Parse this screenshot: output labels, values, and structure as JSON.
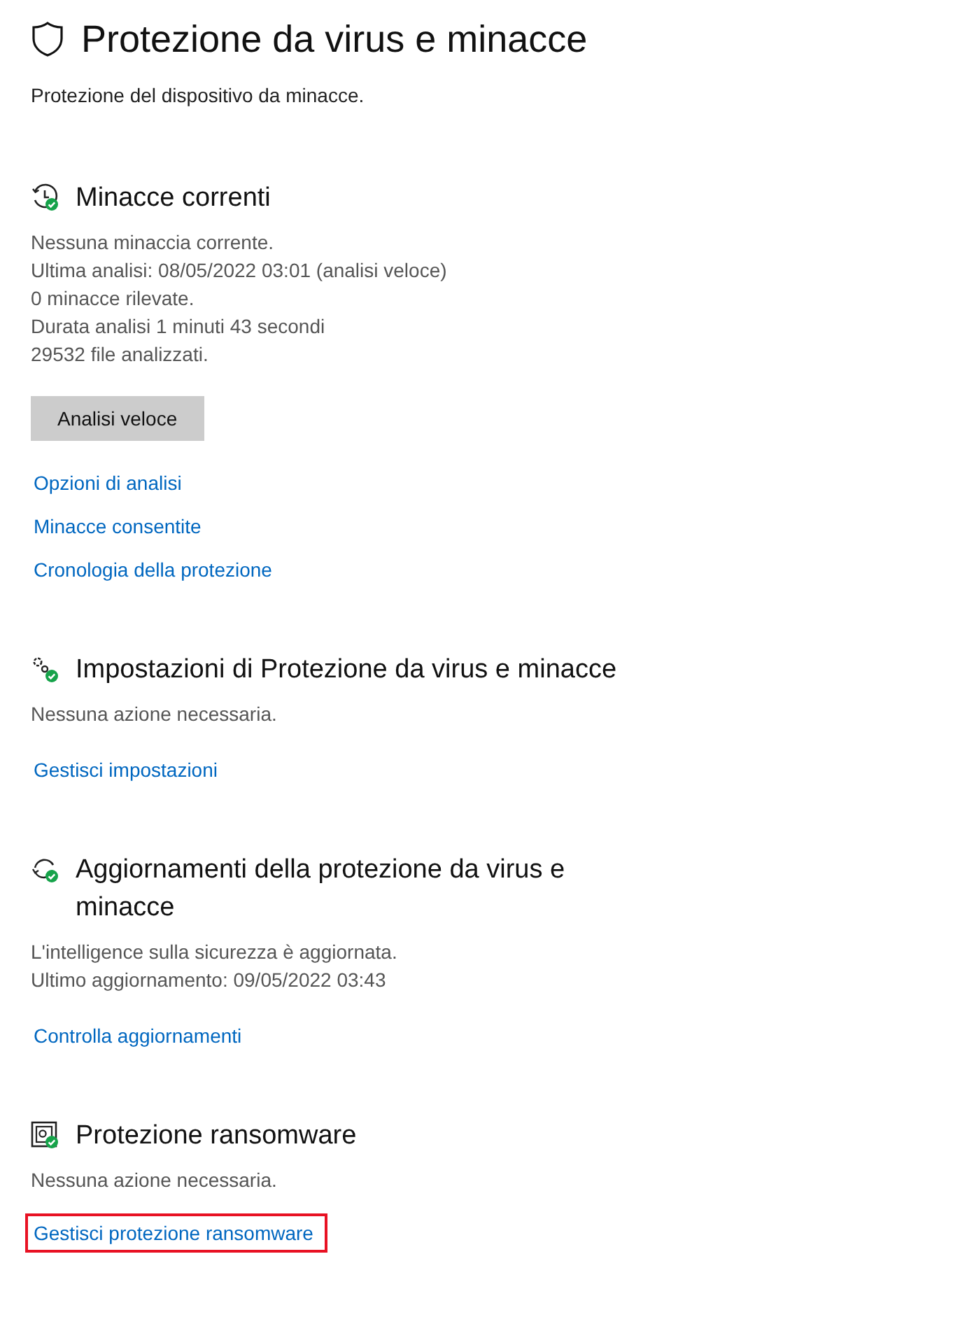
{
  "page": {
    "title": "Protezione da virus e minacce",
    "subtitle": "Protezione del dispositivo da minacce."
  },
  "sections": [
    {
      "kind": "clock",
      "title": "Minacce correnti",
      "lines": [
        "Nessuna minaccia corrente.",
        "Ultima analisi: 08/05/2022 03:01 (analisi veloce)",
        "0 minacce rilevate.",
        "Durata analisi 1 minuti 43 secondi",
        "29532 file analizzati."
      ],
      "button": "Analisi veloce",
      "links": [
        {
          "label": "Opzioni di analisi",
          "highlighted": false
        },
        {
          "label": "Minacce consentite",
          "highlighted": false
        },
        {
          "label": "Cronologia della protezione",
          "highlighted": false
        }
      ]
    },
    {
      "kind": "gears",
      "title": "Impostazioni di Protezione da virus e minacce",
      "lines": [
        "Nessuna azione necessaria."
      ],
      "links": [
        {
          "label": "Gestisci impostazioni",
          "highlighted": false
        }
      ]
    },
    {
      "kind": "sync",
      "title": "Aggiornamenti della protezione da virus e minacce",
      "lines": [
        "L'intelligence sulla sicurezza è aggiornata.",
        "Ultimo aggiornamento: 09/05/2022 03:43"
      ],
      "links": [
        {
          "label": "Controlla aggiornamenti",
          "highlighted": false
        }
      ]
    },
    {
      "kind": "folder",
      "title": "Protezione ransomware",
      "lines": [
        "Nessuna azione necessaria."
      ],
      "links": [
        {
          "label": "Gestisci protezione ransomware",
          "highlighted": true
        }
      ]
    }
  ]
}
